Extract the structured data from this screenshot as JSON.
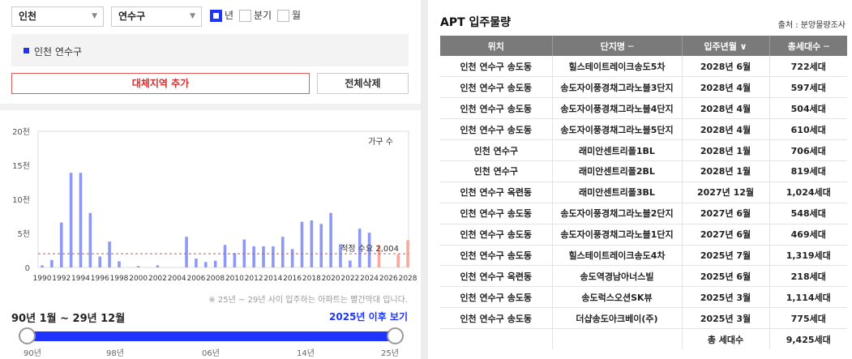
{
  "filters": {
    "city": "인천",
    "district": "연수구",
    "period": [
      {
        "label": "년",
        "checked": true
      },
      {
        "label": "분기",
        "checked": false
      },
      {
        "label": "월",
        "checked": false
      }
    ]
  },
  "region_tag": "인천 연수구",
  "buttons": {
    "add_region": "대체지역 추가",
    "clear_all": "전체삭제"
  },
  "chart_data": {
    "type": "bar",
    "legend": "가구 수",
    "y_ticks": [
      "20천",
      "15천",
      "10천",
      "5천",
      "0"
    ],
    "ylim": [
      0,
      20000
    ],
    "x_tick_labels": [
      "1990",
      "1992",
      "1994",
      "1996",
      "1998",
      "2000",
      "2002",
      "2004",
      "2006",
      "2008",
      "2010",
      "2012",
      "2014",
      "2016",
      "2018",
      "2020",
      "2022",
      "2024",
      "2026",
      "2028"
    ],
    "categories": [
      1990,
      1991,
      1992,
      1993,
      1994,
      1995,
      1996,
      1997,
      1998,
      1999,
      2000,
      2001,
      2002,
      2003,
      2004,
      2005,
      2006,
      2007,
      2008,
      2009,
      2010,
      2011,
      2012,
      2013,
      2014,
      2015,
      2016,
      2017,
      2018,
      2019,
      2020,
      2021,
      2022,
      2023,
      2024,
      2025,
      2026,
      2027,
      2028
    ],
    "values": [
      300,
      1100,
      6600,
      13900,
      13900,
      8000,
      1600,
      3800,
      900,
      0,
      200,
      0,
      300,
      0,
      0,
      4500,
      1300,
      800,
      1000,
      3300,
      2100,
      4100,
      3100,
      3100,
      3100,
      4500,
      2700,
      6700,
      6900,
      6400,
      8000,
      3400,
      1000,
      5700,
      5100,
      3300,
      0,
      1900,
      4000
    ],
    "projected_from": 2025,
    "reference_line": {
      "label": "적정 수요 2,004",
      "value": 2004
    },
    "colors": {
      "actual": "#8e99f5",
      "projected": "#f6a99c",
      "reference": "#e05050"
    }
  },
  "chart_note": "※ 25년 ~ 29년 사이 입주하는 아파트는 빨간막대 입니다.",
  "range": {
    "label": "90년 1월 ~ 29년 12월",
    "link": "2025년 이후 보기",
    "ticks": [
      "90년",
      "98년",
      "06년",
      "14년",
      "25년"
    ]
  },
  "table": {
    "title": "APT 입주물량",
    "source": "출처 : 분양물량조사",
    "headers": [
      "위치",
      "단지명 ─",
      "입주년월 ∨",
      "총세대수 ─"
    ],
    "rows": [
      [
        "인천 연수구 송도동",
        "힐스테이트레이크송도5차",
        "2028년 6월",
        "722세대"
      ],
      [
        "인천 연수구 송도동",
        "송도자이풍경채그라노블3단지",
        "2028년 4월",
        "597세대"
      ],
      [
        "인천 연수구 송도동",
        "송도자이풍경채그라노블4단지",
        "2028년 4월",
        "504세대"
      ],
      [
        "인천 연수구 송도동",
        "송도자이풍경채그라노블5단지",
        "2028년 4월",
        "610세대"
      ],
      [
        "인천 연수구",
        "래미안센트리폴1BL",
        "2028년 1월",
        "706세대"
      ],
      [
        "인천 연수구",
        "래미안센트리폴2BL",
        "2028년 1월",
        "819세대"
      ],
      [
        "인천 연수구 옥련동",
        "래미안센트리폴3BL",
        "2027년 12월",
        "1,024세대"
      ],
      [
        "인천 연수구 송도동",
        "송도자이풍경채그라노블2단지",
        "2027년 6월",
        "548세대"
      ],
      [
        "인천 연수구 송도동",
        "송도자이풍경채그라노블1단지",
        "2027년 6월",
        "469세대"
      ],
      [
        "인천 연수구 송도동",
        "힐스테이트레이크송도4차",
        "2025년 7월",
        "1,319세대"
      ],
      [
        "인천 연수구 옥련동",
        "송도역경남아너스빌",
        "2025년 6월",
        "218세대"
      ],
      [
        "인천 연수구 송도동",
        "송도럭스오션SK뷰",
        "2025년 3월",
        "1,114세대"
      ],
      [
        "인천 연수구 송도동",
        "더샵송도아크베이(주)",
        "2025년 3월",
        "775세대"
      ]
    ],
    "total": {
      "label": "총 세대수",
      "value": "9,425세대"
    }
  }
}
